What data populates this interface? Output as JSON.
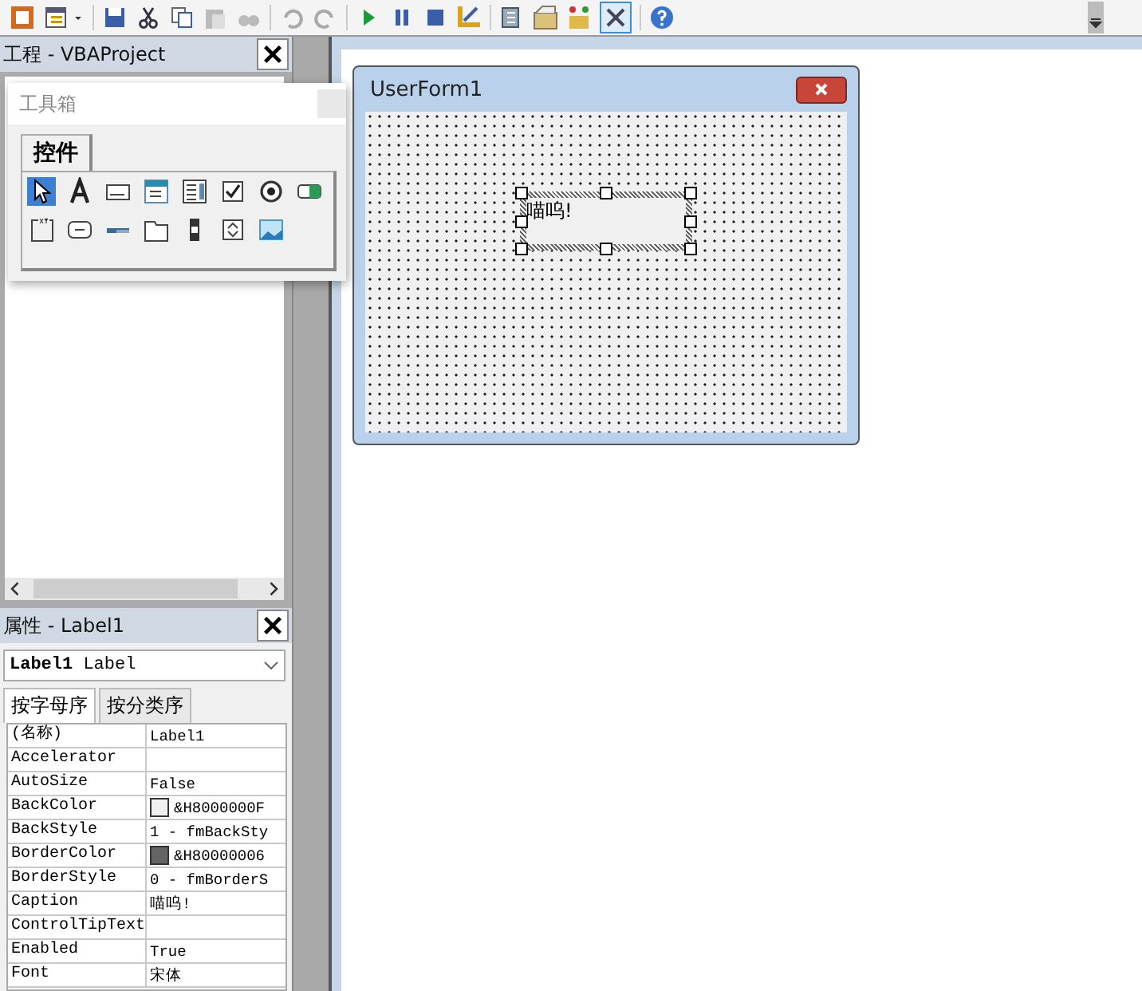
{
  "toolbar": {
    "toolbox_pressed": true
  },
  "project_pane": {
    "title": "工程 - VBAProject"
  },
  "toolbox": {
    "title": "工具箱",
    "tabs": [
      {
        "label": "控件",
        "selected": true
      }
    ],
    "tools": [
      {
        "kind": "pointer",
        "selected": true
      },
      {
        "kind": "label",
        "selected": false
      },
      {
        "kind": "textbox",
        "selected": false
      },
      {
        "kind": "combobox",
        "selected": false
      },
      {
        "kind": "listbox",
        "selected": false
      },
      {
        "kind": "checkbox",
        "selected": false
      },
      {
        "kind": "option",
        "selected": false
      },
      {
        "kind": "toggle",
        "selected": false
      },
      {
        "kind": "frame",
        "selected": false
      },
      {
        "kind": "button",
        "selected": false
      },
      {
        "kind": "tabstrip",
        "selected": false
      },
      {
        "kind": "multipage",
        "selected": false
      },
      {
        "kind": "scrollbar",
        "selected": false
      },
      {
        "kind": "spin",
        "selected": false
      },
      {
        "kind": "image",
        "selected": false
      }
    ]
  },
  "properties": {
    "title": "属性 - Label1",
    "object": "**Label1** Label",
    "tabs": [
      {
        "label": "按字母序",
        "selected": true
      },
      {
        "label": "按分类序",
        "selected": false
      }
    ],
    "rows": [
      {
        "name": "(名称)",
        "value": "Label1"
      },
      {
        "name": "Accelerator",
        "value": ""
      },
      {
        "name": "AutoSize",
        "value": "False"
      },
      {
        "name": "BackColor",
        "value": "&H8000000F",
        "color": "#f0f0f0"
      },
      {
        "name": "BackStyle",
        "value": "1 - fmBackSty"
      },
      {
        "name": "BorderColor",
        "value": "&H80000006",
        "color": "#646464"
      },
      {
        "name": "BorderStyle",
        "value": "0 - fmBorderS"
      },
      {
        "name": "Caption",
        "value": "喵呜!"
      },
      {
        "name": "ControlTipText",
        "value": ""
      },
      {
        "name": "Enabled",
        "value": "True"
      },
      {
        "name": "Font",
        "value": "宋体"
      }
    ]
  },
  "userform": {
    "title": "UserForm1",
    "label": {
      "caption": "喵呜!",
      "selected": true
    }
  }
}
